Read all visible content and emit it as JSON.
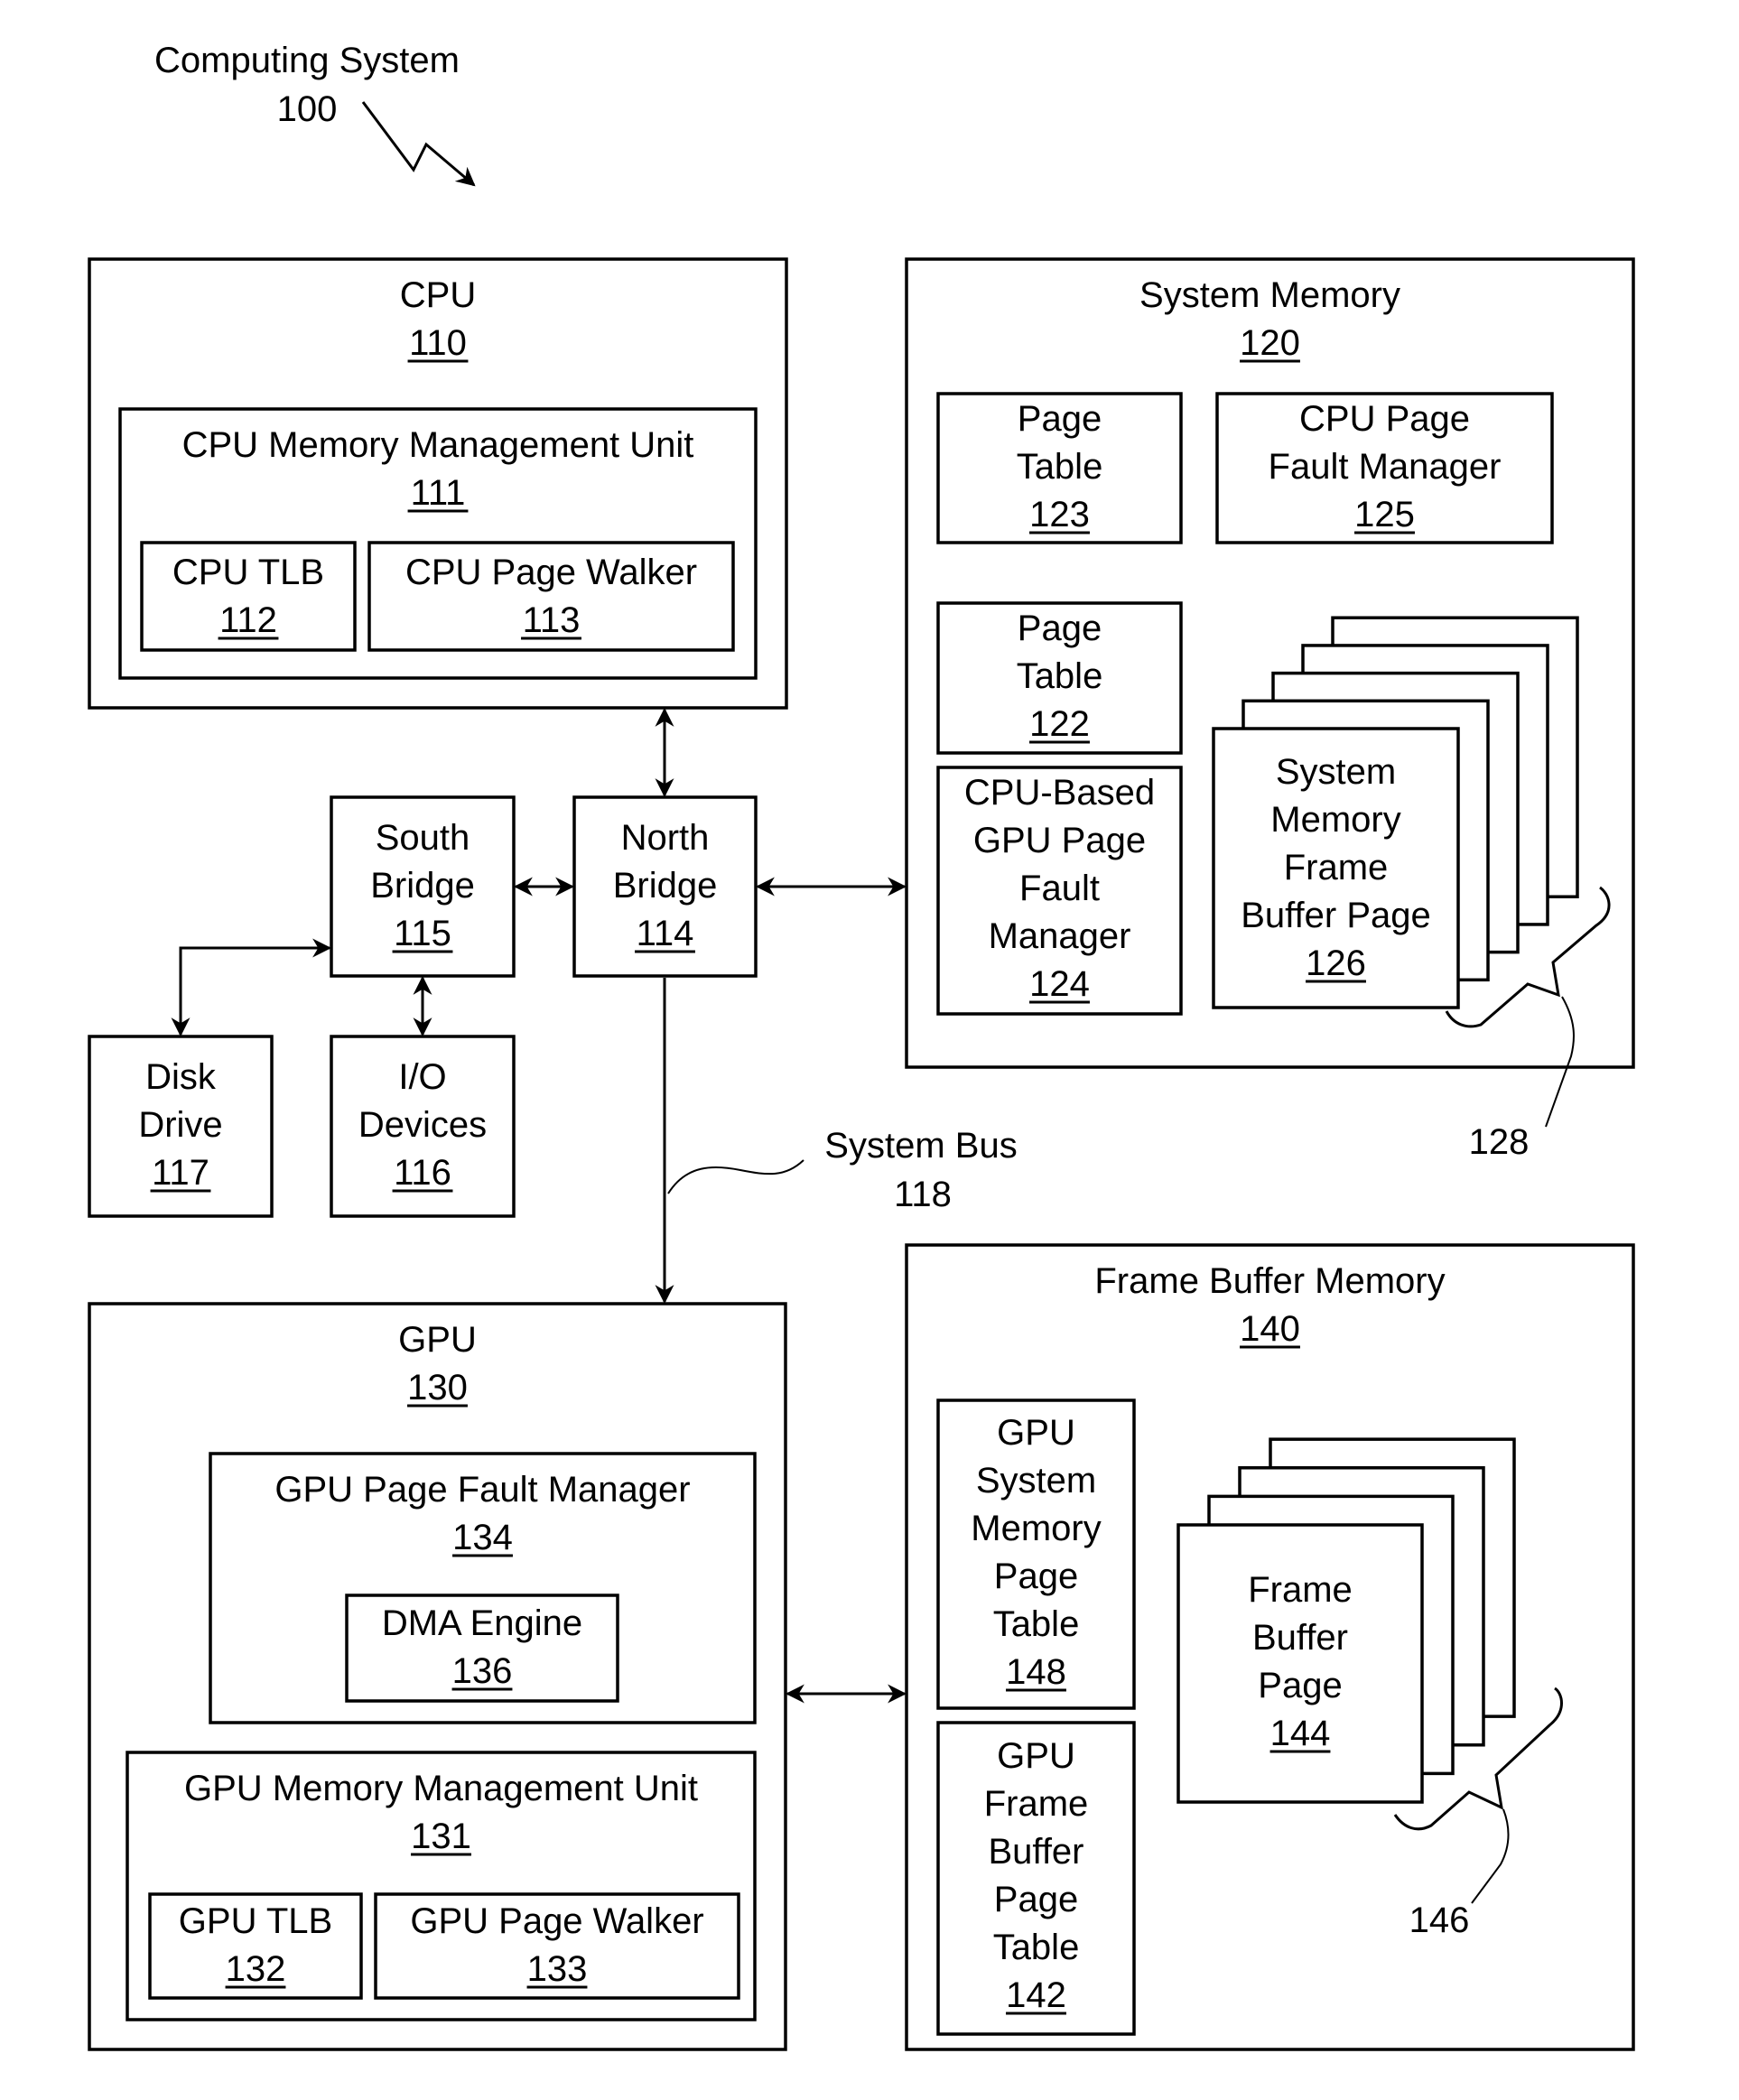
{
  "title": {
    "label": "Computing System",
    "ref": "100"
  },
  "blocks": {
    "cpu": {
      "lines": [
        "CPU"
      ],
      "ref": "110"
    },
    "cpu_mmu": {
      "lines": [
        "CPU Memory Management Unit"
      ],
      "ref": "111"
    },
    "cpu_tlb": {
      "lines": [
        "CPU TLB"
      ],
      "ref": "112"
    },
    "cpu_page_walker": {
      "lines": [
        "CPU Page Walker"
      ],
      "ref": "113"
    },
    "system_memory": {
      "lines": [
        "System Memory"
      ],
      "ref": "120"
    },
    "page_table_123": {
      "lines": [
        "Page",
        "Table"
      ],
      "ref": "123"
    },
    "cpu_page_fault_manager": {
      "lines": [
        "CPU Page",
        "Fault Manager"
      ],
      "ref": "125"
    },
    "page_table_122": {
      "lines": [
        "Page",
        "Table"
      ],
      "ref": "122"
    },
    "cpu_based_gpu_pfm": {
      "lines": [
        "CPU-Based",
        "GPU Page",
        "Fault",
        "Manager"
      ],
      "ref": "124"
    },
    "sys_mem_frame_buffer_page": {
      "lines": [
        "System",
        "Memory",
        "Frame",
        "Buffer Page"
      ],
      "ref": "126"
    },
    "south_bridge": {
      "lines": [
        "South",
        "Bridge"
      ],
      "ref": "115"
    },
    "north_bridge": {
      "lines": [
        "North",
        "Bridge"
      ],
      "ref": "114"
    },
    "disk_drive": {
      "lines": [
        "Disk",
        "Drive"
      ],
      "ref": "117"
    },
    "io_devices": {
      "lines": [
        "I/O",
        "Devices"
      ],
      "ref": "116"
    },
    "gpu": {
      "lines": [
        "GPU"
      ],
      "ref": "130"
    },
    "gpu_page_fault_manager": {
      "lines": [
        "GPU Page Fault Manager"
      ],
      "ref": "134"
    },
    "dma_engine": {
      "lines": [
        "DMA Engine"
      ],
      "ref": "136"
    },
    "gpu_mmu": {
      "lines": [
        "GPU Memory Management Unit"
      ],
      "ref": "131"
    },
    "gpu_tlb": {
      "lines": [
        "GPU TLB"
      ],
      "ref": "132"
    },
    "gpu_page_walker": {
      "lines": [
        "GPU Page Walker"
      ],
      "ref": "133"
    },
    "frame_buffer_memory": {
      "lines": [
        "Frame Buffer Memory"
      ],
      "ref": "140"
    },
    "gpu_sys_mem_page_table": {
      "lines": [
        "GPU",
        "System",
        "Memory",
        "Page",
        "Table"
      ],
      "ref": "148"
    },
    "gpu_fb_page_table": {
      "lines": [
        "GPU",
        "Frame",
        "Buffer",
        "Page",
        "Table"
      ],
      "ref": "142"
    },
    "frame_buffer_page": {
      "lines": [
        "Frame",
        "Buffer",
        "Page"
      ],
      "ref": "144"
    }
  },
  "annotations": {
    "system_bus": {
      "label": "System Bus",
      "ref": "118"
    },
    "group_128": "128",
    "group_146": "146"
  },
  "stacks": {
    "sys_mem_pages_count": 5,
    "frame_buffer_pages_count": 4
  }
}
